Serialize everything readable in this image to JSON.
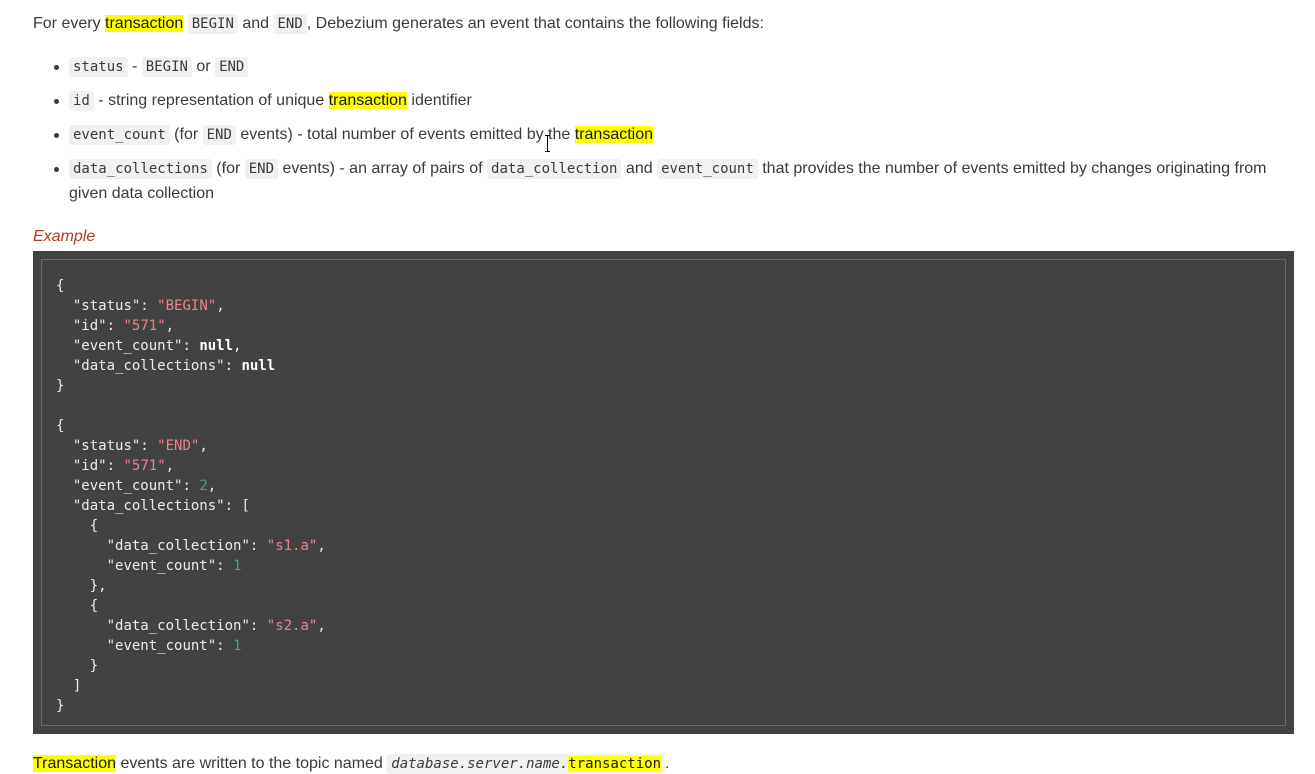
{
  "intro": {
    "prefix": "For every ",
    "highlight": "transaction",
    "code_begin": "BEGIN",
    "and": " and ",
    "code_end": "END",
    "suffix": ", Debezium generates an event that contains the following fields:"
  },
  "fields": [
    {
      "code": "status",
      "text1": " - ",
      "code2": "BEGIN",
      "text2": " or ",
      "code3": "END"
    },
    {
      "code": "id",
      "text1": " - string representation of unique ",
      "highlight": "transaction",
      "text2": " identifier"
    },
    {
      "code": "event_count",
      "text1": " (for ",
      "code2": "END",
      "text2": " events) - total number of events emitted by the ",
      "highlight": "transaction"
    },
    {
      "code": "data_collections",
      "text1": " (for ",
      "code2": "END",
      "text2": " events) - an array of pairs of ",
      "code3": "data_collection",
      "text3": " and ",
      "code4": "event_count",
      "text4": " that provides the number of events emitted by changes originating from given data collection"
    }
  ],
  "example_title": "Example",
  "code_sample": {
    "begin_event": {
      "status": "BEGIN",
      "id": "571",
      "event_count": "null",
      "data_collections": "null"
    },
    "end_event": {
      "status": "END",
      "id": "571",
      "event_count": "2",
      "collections": [
        {
          "data_collection": "s1.a",
          "event_count": "1"
        },
        {
          "data_collection": "s2.a",
          "event_count": "1"
        }
      ]
    },
    "keys": {
      "status": "status",
      "id": "id",
      "event_count": "event_count",
      "data_collections": "data_collections",
      "data_collection": "data_collection"
    }
  },
  "topic_line": {
    "highlight": "Transaction",
    "text": " events are written to the topic named ",
    "code_prefix": "database.server.name.",
    "code_highlight": "transaction",
    "suffix": "."
  }
}
